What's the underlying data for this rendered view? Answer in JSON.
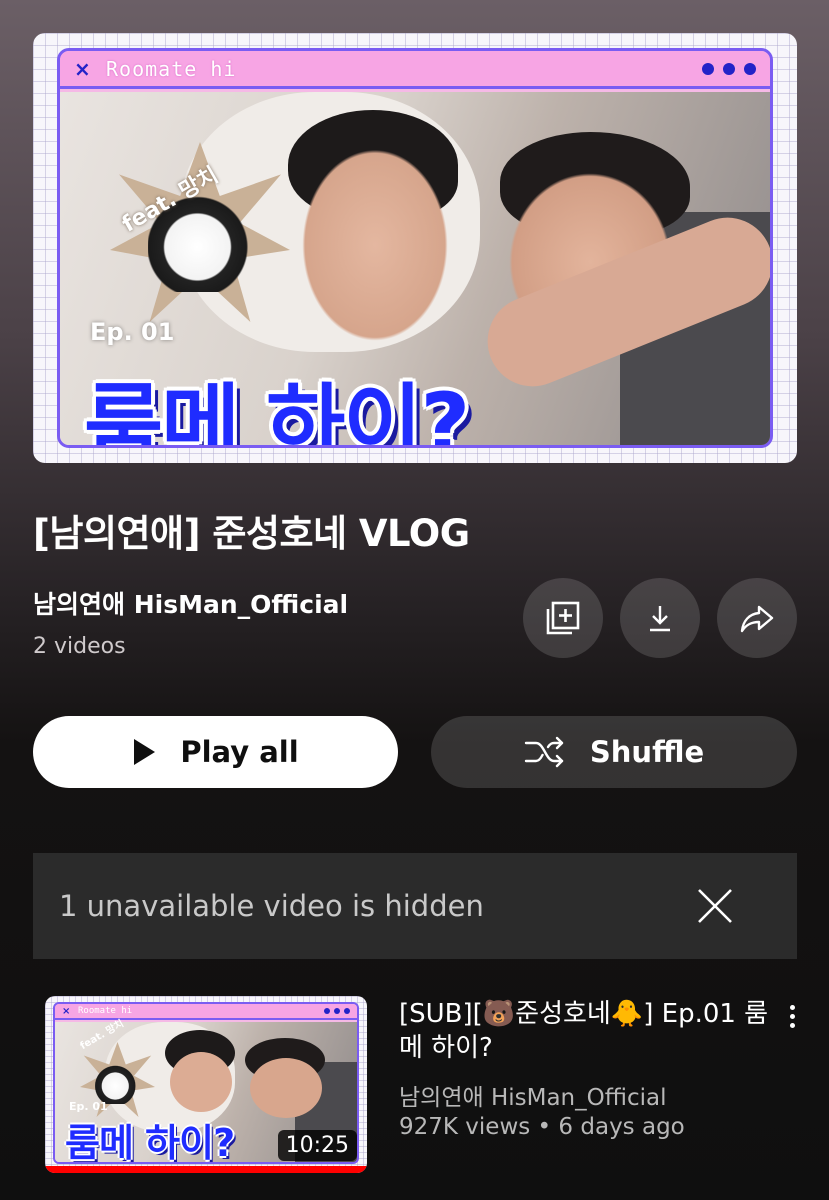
{
  "playlist": {
    "title": "[남의연애] 준성호네 VLOG",
    "channel": "남의연애 HisMan_Official",
    "video_count": "2 videos",
    "thumbnail": {
      "window_title": "Roomate hi",
      "window_close": "×",
      "sticker_text": "feat. 망치",
      "episode": "Ep. 01",
      "headline": "룸메 하이?"
    }
  },
  "actions": {
    "save_icon": "playlist-add-icon",
    "download_icon": "download-icon",
    "share_icon": "share-icon"
  },
  "buttons": {
    "play_all": "Play all",
    "shuffle": "Shuffle"
  },
  "notice": {
    "text": "1 unavailable video is hidden",
    "close_icon": "close-icon"
  },
  "videos": [
    {
      "title": "[SUB][🐻준성호네🐥] Ep.01 룸메 하이?",
      "channel": "남의연애 HisMan_Official",
      "meta": "927K views • 6 days ago",
      "duration": "10:25",
      "watched_fraction": 1.0,
      "thumbnail": {
        "window_title": "Roomate hi",
        "window_close": "×",
        "sticker_text": "feat. 망치",
        "episode": "Ep. 01",
        "headline": "룸메 하이?"
      }
    }
  ],
  "colors": {
    "accent_blue": "#1f2cff",
    "frame_pink": "#f7a5e4",
    "frame_purple": "#7a5cf2",
    "progress_red": "#ff0000"
  }
}
